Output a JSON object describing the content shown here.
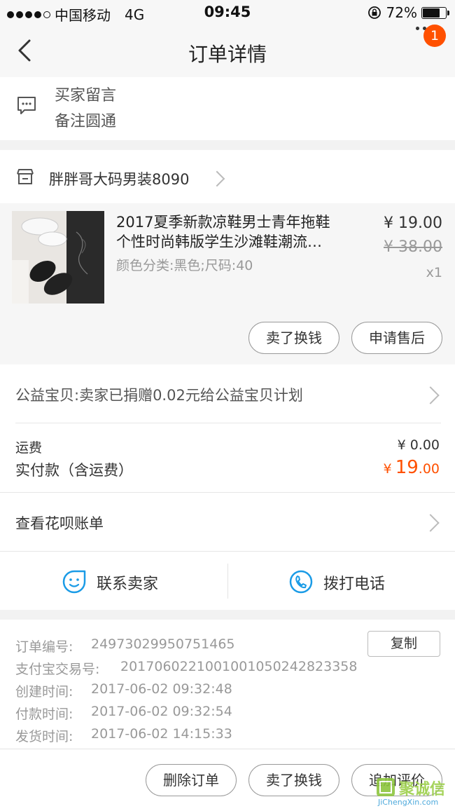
{
  "status_bar": {
    "carrier": "中国移动",
    "network": "4G",
    "time": "09:45",
    "battery": "72%"
  },
  "nav": {
    "title": "订单详情",
    "badge_count": "1"
  },
  "buyer_message": {
    "label": "买家留言",
    "content": "备注圆通"
  },
  "shop": {
    "name": "胖胖哥大码男装8090"
  },
  "product": {
    "title_line1": "2017夏季新款凉鞋男士青年拖鞋",
    "title_line2": "个性时尚韩版学生沙滩鞋潮流…",
    "spec": "颜色分类:黑色;尺码:40",
    "price": "¥ 19.00",
    "original_price": "¥ 38.00",
    "quantity": "x1"
  },
  "item_actions": {
    "sell": "卖了换钱",
    "after_sale": "申请售后"
  },
  "charity": {
    "text": "公益宝贝:卖家已捐赠0.02元给公益宝贝计划"
  },
  "fees": {
    "shipping_label": "运费",
    "shipping_value": "¥ 0.00",
    "paid_label": "实付款（含运费）",
    "paid_currency": "¥",
    "paid_int": "19",
    "paid_dec": ".00"
  },
  "huabei": {
    "text": "查看花呗账单"
  },
  "contact": {
    "seller": "联系卖家",
    "phone": "拨打电话"
  },
  "order_info": {
    "order_no_label": "订单编号:",
    "order_no": "24973029950751465",
    "copy_button": "复制",
    "alipay_label": "支付宝交易号:",
    "alipay_no": "2017060221001001050242823358",
    "created_label": "创建时间:",
    "created": "2017-06-02 09:32:48",
    "paid_label": "付款时间:",
    "paid": "2017-06-02 09:32:54",
    "shipped_label": "发货时间:",
    "shipped": "2017-06-02 14:15:33"
  },
  "bottom_actions": {
    "delete": "删除订单",
    "sell": "卖了换钱",
    "review": "追加评价"
  },
  "watermark": {
    "text": "JiChengXin.com",
    "logo_text": "聚诚信"
  },
  "colors": {
    "accent": "#ff5000",
    "icon_blue": "#1a9be6"
  }
}
